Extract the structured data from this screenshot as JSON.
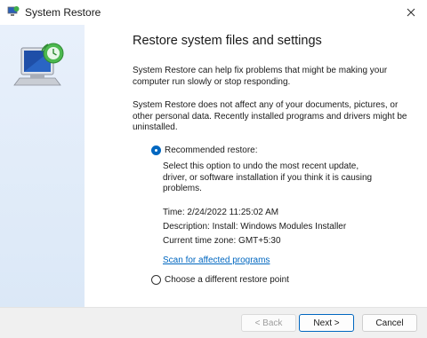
{
  "window": {
    "title": "System Restore",
    "icon": "system-restore-icon",
    "close_icon": "close-icon"
  },
  "sidebar": {
    "art_icon": "restore-monitor-icon"
  },
  "content": {
    "heading": "Restore system files and settings",
    "para1": "System Restore can help fix problems that might be making your computer run slowly or stop responding.",
    "para2": "System Restore does not affect any of your documents, pictures, or other personal data. Recently installed programs and drivers might be uninstalled.",
    "recommended": {
      "label": "Recommended restore:",
      "selected": true,
      "description": "Select this option to undo the most recent update, driver, or software installation if you think it is causing problems.",
      "time": "Time: 2/24/2022 11:25:02 AM",
      "desc_line": "Description: Install: Windows Modules Installer",
      "timezone": "Current time zone: GMT+5:30",
      "scan_link": "Scan for affected programs"
    },
    "different": {
      "label": "Choose a different restore point",
      "selected": false
    }
  },
  "footer": {
    "back": "< Back",
    "next": "Next >",
    "cancel": "Cancel"
  },
  "colors": {
    "accent": "#0067c0",
    "sidebar": "#dbe8f7",
    "footer": "#f0f0f0"
  }
}
